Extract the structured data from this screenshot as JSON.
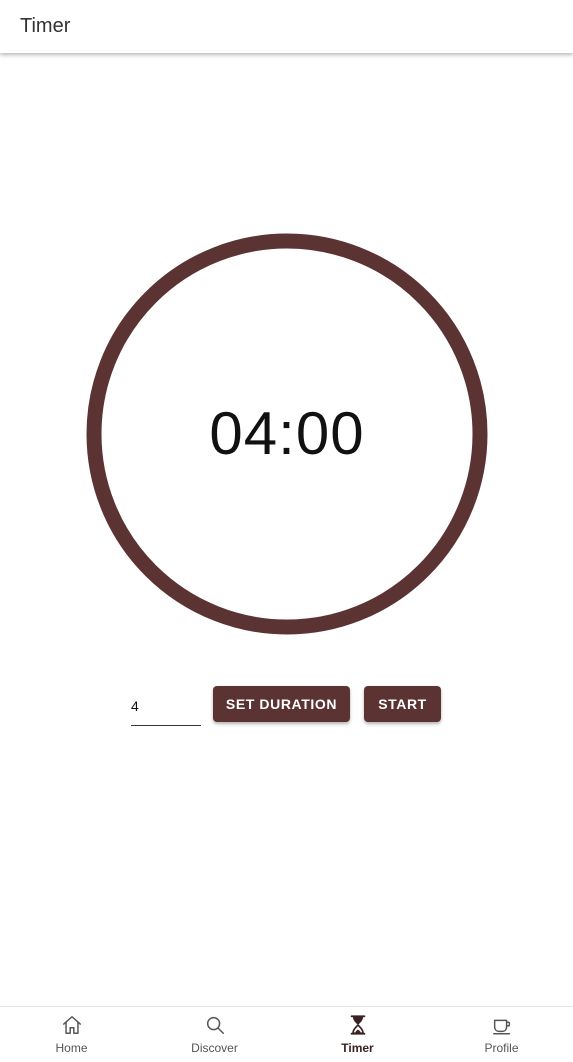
{
  "app_bar": {
    "title": "Timer"
  },
  "timer": {
    "display": "04:00",
    "ring_color": "#5c3333"
  },
  "controls": {
    "duration_value": "4",
    "set_duration_label": "SET DURATION",
    "start_label": "START",
    "button_color": "#5c3333"
  },
  "bottom_nav": {
    "items": [
      {
        "label": "Home",
        "icon": "home-icon",
        "active": false
      },
      {
        "label": "Discover",
        "icon": "search-icon",
        "active": false
      },
      {
        "label": "Timer",
        "icon": "hourglass-icon",
        "active": true
      },
      {
        "label": "Profile",
        "icon": "coffee-cup-icon",
        "active": false
      }
    ]
  }
}
